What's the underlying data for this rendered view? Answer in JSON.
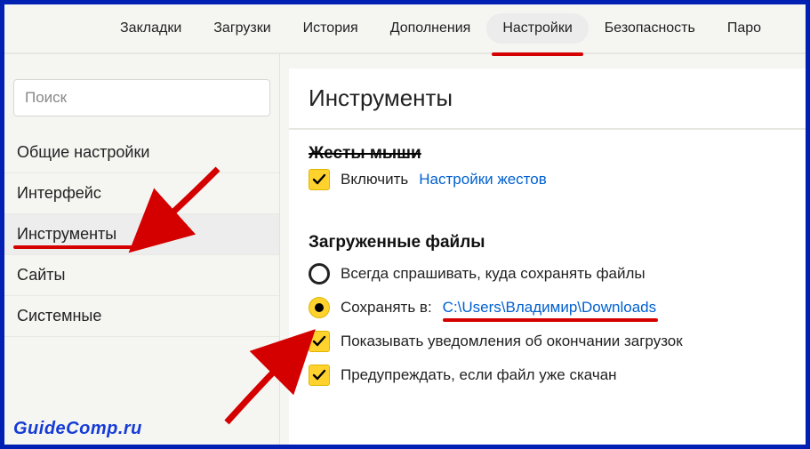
{
  "topbar": {
    "tabs": [
      {
        "label": "Закладки"
      },
      {
        "label": "Загрузки"
      },
      {
        "label": "История"
      },
      {
        "label": "Дополнения"
      },
      {
        "label": "Настройки"
      },
      {
        "label": "Безопасность"
      },
      {
        "label": "Паро"
      }
    ],
    "active_index": 4
  },
  "sidebar": {
    "search_placeholder": "Поиск",
    "items": [
      {
        "label": "Общие настройки"
      },
      {
        "label": "Интерфейс"
      },
      {
        "label": "Инструменты"
      },
      {
        "label": "Сайты"
      },
      {
        "label": "Системные"
      }
    ],
    "active_index": 2
  },
  "main": {
    "title": "Инструменты",
    "mouse_gestures": {
      "heading_cut": "Жесты мыши",
      "enable_label": "Включить",
      "settings_link": "Настройки жестов"
    },
    "downloads": {
      "heading": "Загруженные файлы",
      "ask_label": "Всегда спрашивать, куда сохранять файлы",
      "save_to_label": "Сохранять в:",
      "save_to_path": "C:\\Users\\Владимир\\Downloads",
      "notify_label": "Показывать уведомления об окончании загрузок",
      "warn_label": "Предупреждать, если файл уже скачан"
    }
  },
  "watermark": "GuideComp.ru"
}
